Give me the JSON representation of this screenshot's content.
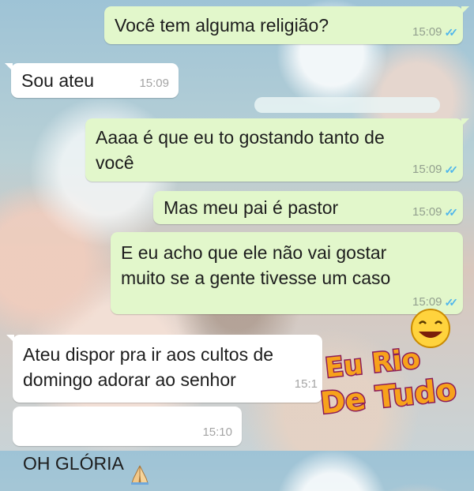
{
  "messages": [
    {
      "text": "Você tem alguma religião?",
      "time": "15:09",
      "ticks": "✓✓"
    },
    {
      "text": "Sou ateu",
      "time": "15:09"
    },
    {
      "text": "Aaaa é que eu to gostando tanto de\nvocê",
      "time": "15:09",
      "ticks": "✓✓"
    },
    {
      "text": "Mas meu pai é pastor",
      "time": "15:09",
      "ticks": "✓✓"
    },
    {
      "text": "E eu acho que ele não vai gostar\nmuito se a gente tivesse um caso",
      "time": "15:09",
      "ticks": "✓✓"
    },
    {
      "text": "Ateu dispor pra ir aos cultos de\ndomingo adorar ao senhor",
      "time": "15:1"
    },
    {
      "text": "OH GLÓRIA",
      "time": "15:10",
      "emoji": "praying-hands-icon"
    }
  ],
  "watermark": {
    "line1": "Eu Rio",
    "line2": "De Tudo",
    "icon": "smiley-face-icon"
  },
  "colors": {
    "outgoing": "#e2f7cb",
    "incoming": "#ffffff",
    "read_ticks": "#4fb6ec"
  }
}
